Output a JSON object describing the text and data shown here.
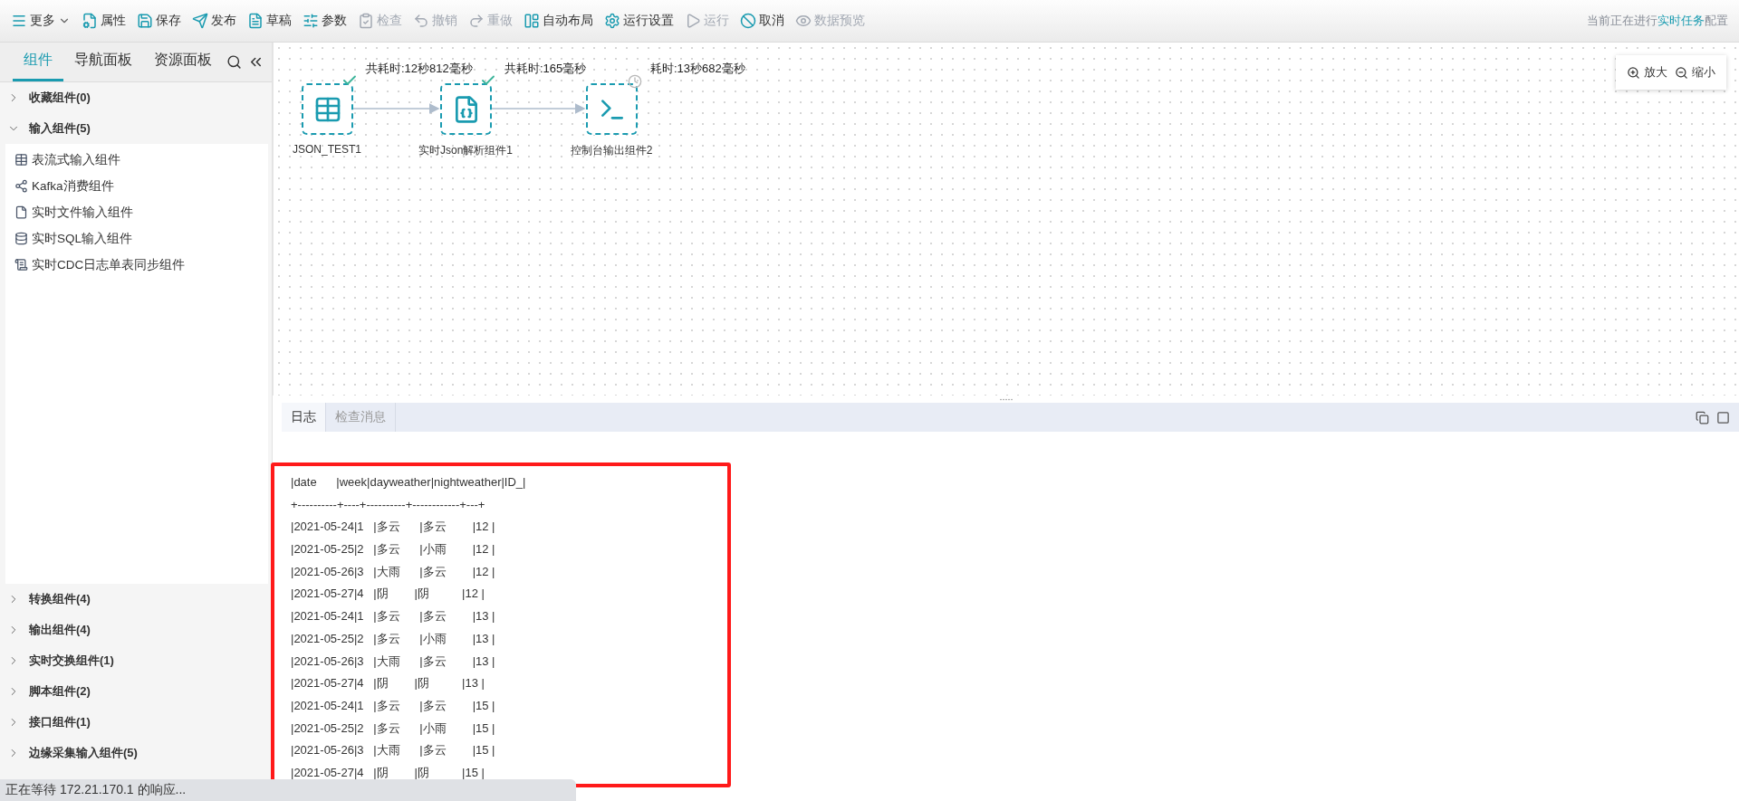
{
  "toolbar": {
    "items": [
      {
        "label": "更多",
        "kind": "menu",
        "disabled": false
      },
      {
        "label": "属性",
        "kind": "button",
        "disabled": false
      },
      {
        "label": "保存",
        "kind": "button",
        "disabled": false
      },
      {
        "label": "发布",
        "kind": "button",
        "disabled": false
      },
      {
        "label": "草稿",
        "kind": "button",
        "disabled": false
      },
      {
        "label": "参数",
        "kind": "button",
        "disabled": false
      },
      {
        "label": "检查",
        "kind": "button",
        "disabled": true
      },
      {
        "label": "撤销",
        "kind": "button",
        "disabled": true
      },
      {
        "label": "重做",
        "kind": "button",
        "disabled": true
      },
      {
        "label": "自动布局",
        "kind": "button",
        "disabled": false
      },
      {
        "label": "运行设置",
        "kind": "button",
        "disabled": false
      },
      {
        "label": "运行",
        "kind": "button",
        "disabled": true
      },
      {
        "label": "取消",
        "kind": "button",
        "disabled": false
      },
      {
        "label": "数据预览",
        "kind": "button",
        "disabled": true
      }
    ],
    "status": {
      "prefix": "当前正在进行",
      "highlight": "实时任务",
      "suffix": "配置"
    }
  },
  "sidebar": {
    "tabs": [
      {
        "label": "组件",
        "selected": true
      },
      {
        "label": "导航面板",
        "selected": false
      },
      {
        "label": "资源面板",
        "selected": false
      }
    ],
    "groups": [
      {
        "label": "收藏组件(0)",
        "expanded": false
      },
      {
        "label": "输入组件(5)",
        "expanded": true,
        "items": [
          {
            "label": "表流式输入组件"
          },
          {
            "label": "Kafka消费组件"
          },
          {
            "label": "实时文件输入组件"
          },
          {
            "label": "实时SQL输入组件"
          },
          {
            "label": "实时CDC日志单表同步组件"
          }
        ]
      },
      {
        "label": "转换组件(4)",
        "expanded": false
      },
      {
        "label": "输出组件(4)",
        "expanded": false
      },
      {
        "label": "实时交换组件(1)",
        "expanded": false
      },
      {
        "label": "脚本组件(2)",
        "expanded": false
      },
      {
        "label": "接口组件(1)",
        "expanded": false
      },
      {
        "label": "边缘采集输入组件(5)",
        "expanded": false
      }
    ]
  },
  "canvas": {
    "nodes": [
      {
        "label": "JSON_TEST1",
        "timing": "共耗时:12秒812毫秒",
        "completed": true
      },
      {
        "label": "实时Json解析组件1",
        "timing": "共耗时:165毫秒",
        "completed": true
      },
      {
        "label": "控制台输出组件2",
        "timing": "耗时:13秒682毫秒",
        "completed": false
      }
    ],
    "zoom_controls": [
      "放大",
      "缩小"
    ]
  },
  "log_panel": {
    "tabs": [
      {
        "label": "日志",
        "selected": true
      },
      {
        "label": "检查消息",
        "selected": false
      }
    ],
    "lines": [
      "|date      |week|dayweather|nightweather|ID_|",
      "+----------+----+----------+------------+---+",
      "|2021-05-24|1   |多云      |多云        |12 |",
      "|2021-05-25|2   |多云      |小雨        |12 |",
      "|2021-05-26|3   |大雨      |多云        |12 |",
      "|2021-05-27|4   |阴        |阴          |12 |",
      "|2021-05-24|1   |多云      |多云        |13 |",
      "|2021-05-25|2   |多云      |小雨        |13 |",
      "|2021-05-26|3   |大雨      |多云        |13 |",
      "|2021-05-27|4   |阴        |阴          |13 |",
      "|2021-05-24|1   |多云      |多云        |15 |",
      "|2021-05-25|2   |多云      |小雨        |15 |",
      "|2021-05-26|3   |大雨      |多云        |15 |",
      "|2021-05-27|4   |阴        |阴          |15 |"
    ]
  },
  "status_bar": {
    "text": "正在等待 172.21.170.1 的响应..."
  }
}
